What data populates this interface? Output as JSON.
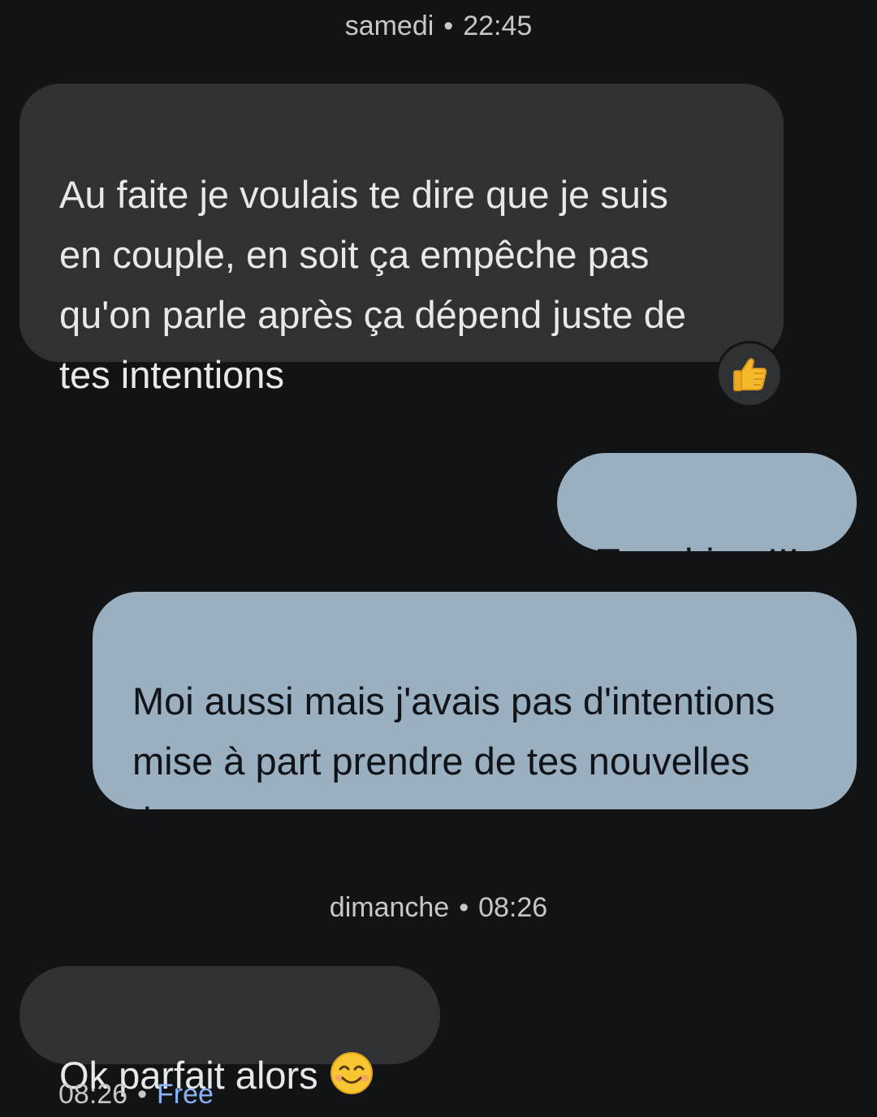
{
  "separators": [
    {
      "day": "samedi",
      "dot": "•",
      "time": "22:45"
    },
    {
      "day": "dimanche",
      "dot": "•",
      "time": "08:26"
    }
  ],
  "messages": [
    {
      "direction": "incoming",
      "text": "Au faite je voulais te dire que je suis\nen couple, en soit ça empêche pas\nqu'on parle après ça dépend juste de\ntes intentions",
      "reaction": "thumbs-up-icon"
    },
    {
      "direction": "outgoing",
      "text": "Trop bien !!!"
    },
    {
      "direction": "outgoing",
      "text": "Moi aussi mais j'avais pas d'intentions\nmise à part prendre de tes nouvelles\ntkt"
    },
    {
      "direction": "incoming",
      "text": "Ok parfait alors",
      "emoji": "smiling-face-icon"
    }
  ],
  "last_message_meta": {
    "time": "08:26",
    "dot": "•",
    "carrier": "Free"
  },
  "colors": {
    "background": "#121315",
    "incoming_bubble": "#303134",
    "outgoing_bubble": "#9aafbf",
    "carrier_link": "#8ab4f8"
  }
}
